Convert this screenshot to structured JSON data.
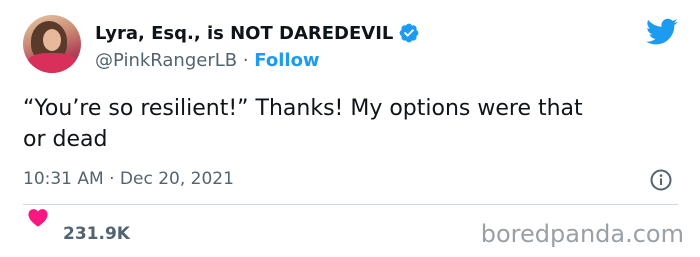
{
  "tweet": {
    "display_name": "Lyra, Esq., is NOT DAREDEVIL",
    "handle": "@PinkRangerLB",
    "separator": " · ",
    "follow_label": "Follow",
    "text_line1": "“You’re so resilient!” Thanks! My options were that",
    "text_line2": "or dead",
    "time": "10:31 AM",
    "date_separator": " · ",
    "date": "Dec 20, 2021",
    "like_count": "231.9K"
  },
  "watermark": "boredpanda.com",
  "colors": {
    "twitter_blue": "#1d9bf0",
    "heart_red": "#f91880",
    "secondary_text": "#536471",
    "divider": "#cfd9de"
  },
  "icons": {
    "verified": "verified-badge-icon",
    "brand": "twitter-bird-icon",
    "info": "info-icon",
    "like": "heart-icon"
  }
}
